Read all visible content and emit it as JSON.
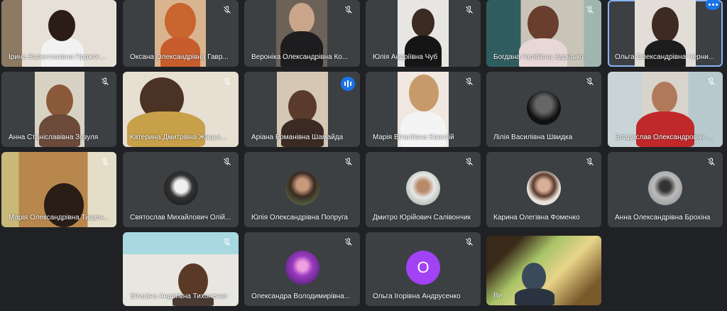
{
  "meeting": {
    "participants": [
      {
        "name": "Ірина Валентинівна Прожогана",
        "muted": false
      },
      {
        "name": "Оксана Олександрівна Гавр...",
        "muted": true
      },
      {
        "name": "Вероніка Олександрівна Ко...",
        "muted": true
      },
      {
        "name": "Юлія Андріївна Чуб",
        "muted": true
      },
      {
        "name": "Богдана Галібівна Здрілько",
        "muted": true
      },
      {
        "name": "Ольга Олександрівна Черни...",
        "muted": false,
        "more_options": true
      },
      {
        "name": "Анна Станіславівна Зозуля",
        "muted": true
      },
      {
        "name": "Катерина Дмитрівна Жицьк...",
        "muted": true
      },
      {
        "name": "Аріана Романівна Шамайда",
        "muted": false,
        "speaking": true
      },
      {
        "name": "Марія Віталіївна Євентій",
        "muted": true
      },
      {
        "name": "Лілія Василівна Швидка",
        "muted": true
      },
      {
        "name": "Владислав Олександрович ...",
        "muted": true
      },
      {
        "name": "Марія Олександрівна Тищен...",
        "muted": true
      },
      {
        "name": "Святослав Михайлович Олій...",
        "muted": true
      },
      {
        "name": "Юлія Олександрівна Попруга",
        "muted": true
      },
      {
        "name": "Дмитро Юрійович Салівончик",
        "muted": true
      },
      {
        "name": "Карина Олегівна Фоменко",
        "muted": true
      },
      {
        "name": "Анна Олександрівна Брохіна",
        "muted": true
      },
      {
        "name": "Віталіна Андріївна Тихоненко",
        "muted": true
      },
      {
        "name": "Олександра Володимирівна...",
        "muted": true
      },
      {
        "name": "Ольга Ігорівна Андрусенко",
        "muted": true,
        "avatar_letter": "О"
      },
      {
        "name": "Ви",
        "muted": false
      }
    ]
  },
  "colors": {
    "background": "#202124",
    "tile": "#3c4043",
    "speaking_indicator": "#1a73e8",
    "selected_outline": "#8ab4f8",
    "letter_avatar": "#a142f4"
  },
  "icons": {
    "muted": "mic-off-icon",
    "speaking": "audio-level-icon",
    "more": "more-options-icon"
  }
}
